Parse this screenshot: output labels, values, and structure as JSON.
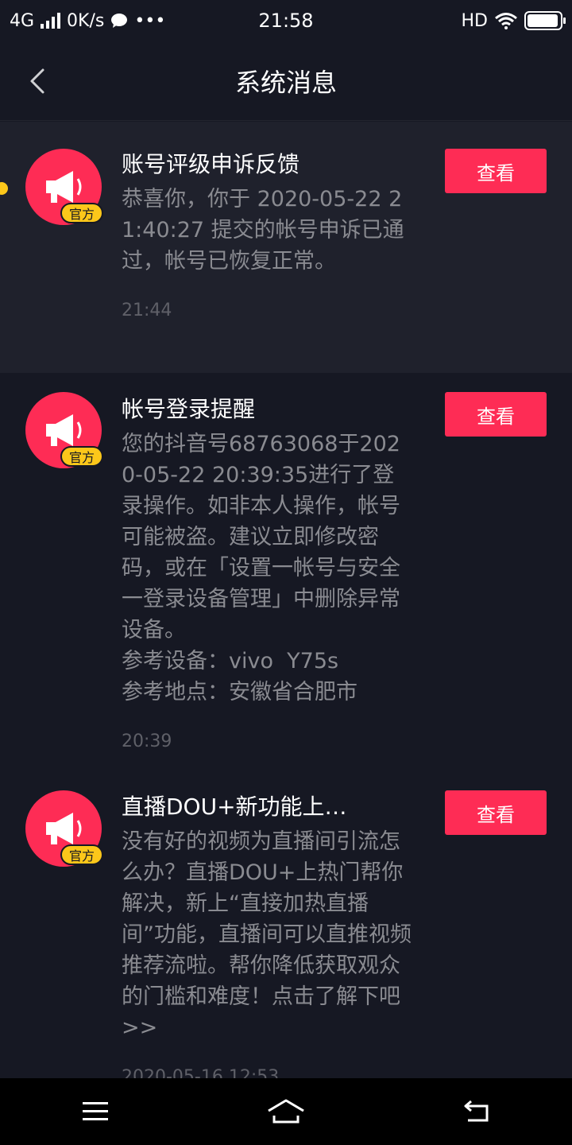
{
  "status_bar": {
    "network": "4G",
    "speed": "0K/s",
    "more": "•••",
    "time": "21:58",
    "hd": "HD",
    "battery_level": 0.95
  },
  "header": {
    "title": "系统消息"
  },
  "messages": [
    {
      "title": "账号评级申诉反馈",
      "body": "恭喜你，你于 2020-05-22 21:40:27 提交的帐号申诉已通过，帐号已恢复正常。",
      "time": "21:44",
      "badge": "官方",
      "button": "查看"
    },
    {
      "title": "帐号登录提醒",
      "body": "您的抖音号68763068于2020-05-22 20:39:35进行了登录操作。如非本人操作，帐号可能被盗。建议立即修改密码，或在「设置一帐号与安全一登录设备管理」中删除异常设备。\n参考设备：vivo  Y75s\n参考地点：安徽省合肥市",
      "time": "20:39",
      "badge": "官方",
      "button": "查看"
    },
    {
      "title": "直播DOU+新功能上…",
      "body": "没有好的视频为直播间引流怎么办？直播DOU+上热门帮你解决，新上“直接加热直播间”功能，直播间可以直推视频推荐流啦。帮你降低获取观众的门槛和难度！点击了解下吧>>",
      "time": "2020-05-16 12:53",
      "badge": "官方",
      "button": "查看"
    }
  ],
  "icons": {
    "back": "chevron-left-icon",
    "avatar": "megaphone-icon",
    "nav_menu": "menu-icon",
    "nav_home": "home-icon",
    "nav_back": "return-icon"
  },
  "colors": {
    "background": "#161823",
    "highlight_row": "#1f212c",
    "accent": "#fe2c55",
    "badge": "#fcc71a",
    "secondary_text": "#8a8b91"
  }
}
